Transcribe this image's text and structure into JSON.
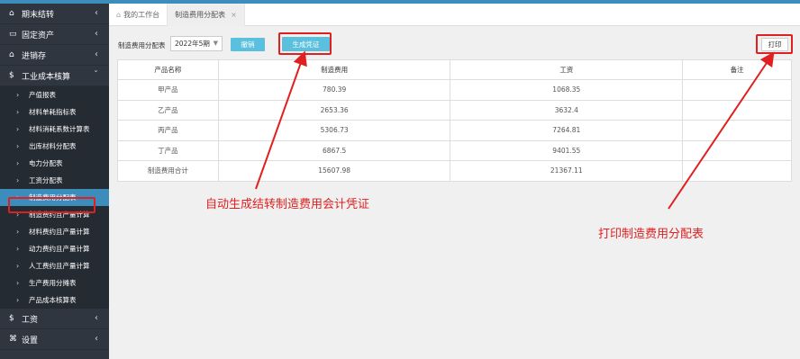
{
  "sidebar": {
    "groups_top": [
      {
        "icon": "⌂",
        "label": "期末结转"
      },
      {
        "icon": "▭",
        "label": "固定资产"
      },
      {
        "icon": "⌂",
        "label": "进销存"
      },
      {
        "icon": "$",
        "label": "工业成本核算"
      }
    ],
    "items": [
      "产值报表",
      "材料单耗指标表",
      "材料消耗系数计算表",
      "出库材料分配表",
      "电力分配表",
      "工资分配表",
      "制造费用分配表",
      "制造费约且产量计算",
      "材料费约且产量计算",
      "动力费约且产量计算",
      "人工费约且产量计算",
      "生产费用分摊表",
      "产品成本核算表"
    ],
    "active_index": 6,
    "groups_bottom": [
      {
        "icon": "$",
        "label": "工资"
      },
      {
        "icon": "⌘",
        "label": "设置"
      }
    ]
  },
  "tabs": [
    {
      "label": "我的工作台",
      "icon": "home-icon"
    },
    {
      "label": "制造费用分配表",
      "close": "×"
    }
  ],
  "toolbar": {
    "label": "制造费用分配表",
    "period": "2022年5期",
    "undo_label": "撤销",
    "generate_label": "生成凭证",
    "print_label": "打印"
  },
  "table": {
    "headers": [
      "产品名称",
      "制造费用",
      "工资",
      "备注"
    ],
    "rows": [
      [
        "甲产品",
        "780.39",
        "1068.35",
        ""
      ],
      [
        "乙产品",
        "2653.36",
        "3632.4",
        ""
      ],
      [
        "丙产品",
        "5306.73",
        "7264.81",
        ""
      ],
      [
        "丁产品",
        "6867.5",
        "9401.55",
        ""
      ],
      [
        "制造费用合计",
        "15607.98",
        "21367.11",
        ""
      ]
    ]
  },
  "annotations": {
    "generate_note": "自动生成结转制造费用会计凭证",
    "print_note": "打印制造费用分配表"
  },
  "colors": {
    "accent": "#3c8dbc",
    "button": "#5bc0de",
    "annotation": "#e02020",
    "sidebar_bg": "#2f3640"
  }
}
